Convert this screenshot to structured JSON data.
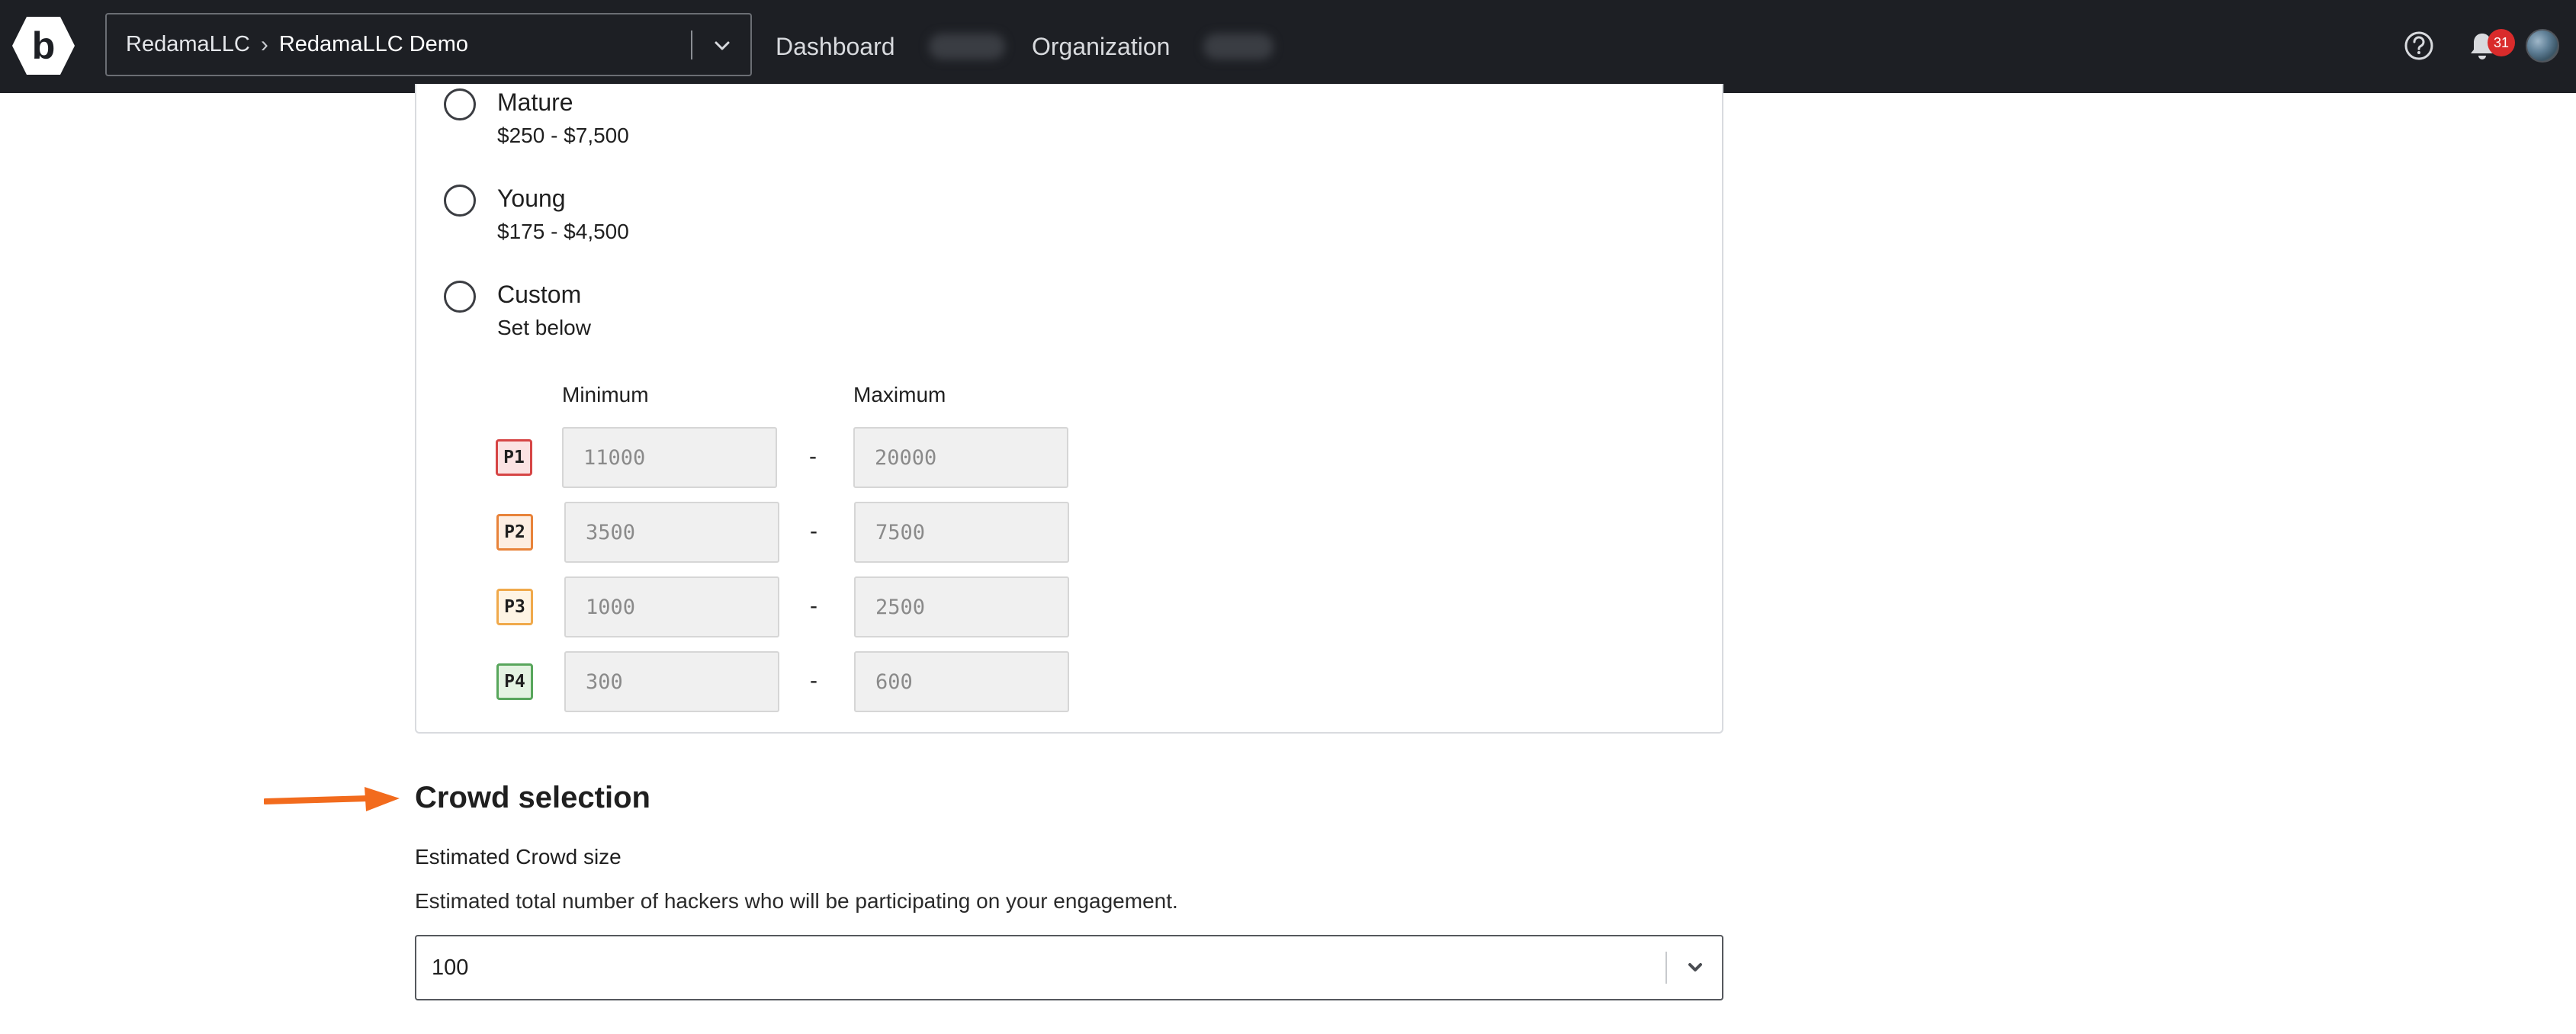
{
  "nav": {
    "org_parent": "RedamaLLC",
    "org_current": "RedamaLLC Demo",
    "links": [
      "Dashboard",
      "Organization"
    ],
    "notification_count": "31",
    "colors": {
      "background": "#1d1f24",
      "badge": "#d92b2b"
    }
  },
  "reward_options": [
    {
      "title": "Mature",
      "range": "$250 - $7,500"
    },
    {
      "title": "Young",
      "range": "$175 - $4,500"
    },
    {
      "title": "Custom",
      "range": "Set below"
    }
  ],
  "custom_table": {
    "min_header": "Minimum",
    "max_header": "Maximum",
    "separator": "-",
    "rows": [
      {
        "priority": "P1",
        "min": "11000",
        "max": "20000",
        "color": "#d64545"
      },
      {
        "priority": "P2",
        "min": "3500",
        "max": "7500",
        "color": "#e8833a"
      },
      {
        "priority": "P3",
        "min": "1000",
        "max": "2500",
        "color": "#f0a94b"
      },
      {
        "priority": "P4",
        "min": "300",
        "max": "600",
        "color": "#58a65c"
      }
    ]
  },
  "crowd": {
    "title": "Crowd selection",
    "label": "Estimated Crowd size",
    "help": "Estimated total number of hackers who will be participating on your engagement.",
    "value": "100",
    "arrow_color": "#f26b1d"
  }
}
